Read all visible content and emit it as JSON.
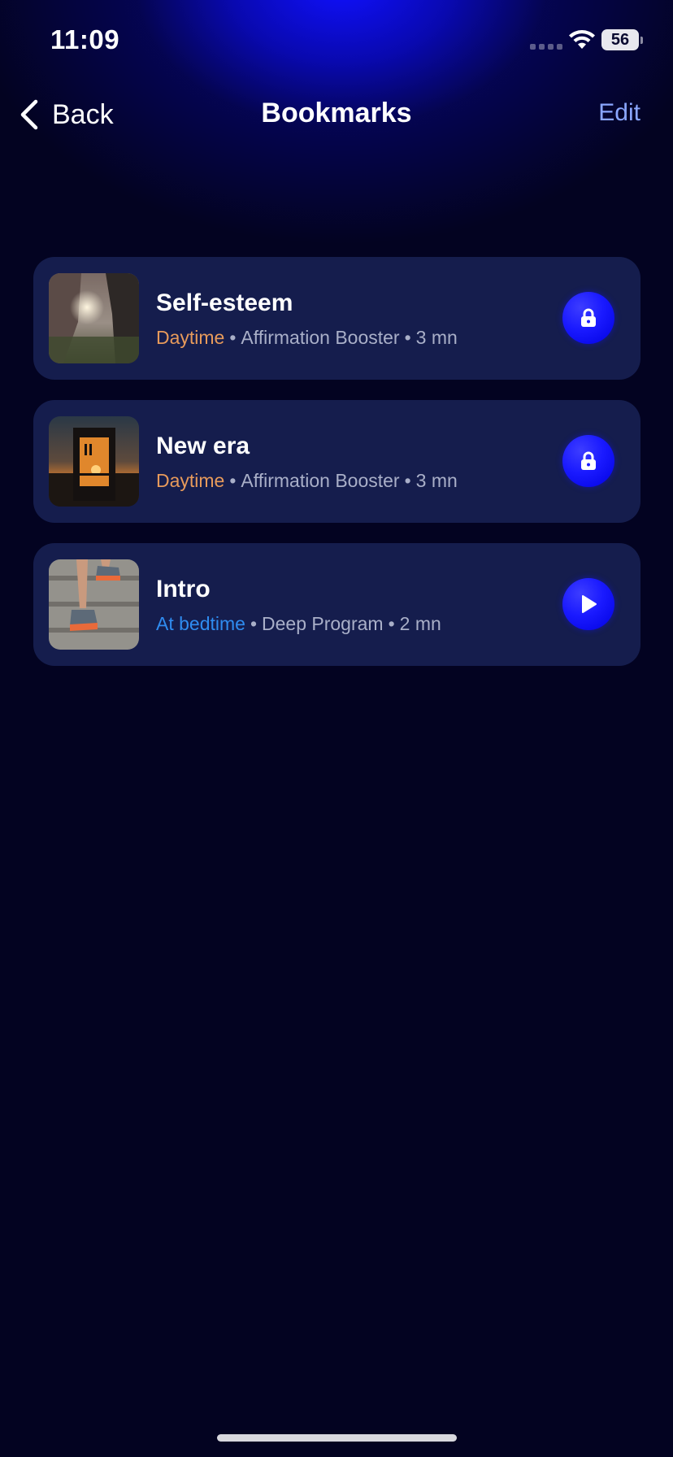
{
  "status_bar": {
    "time": "11:09",
    "battery_level": "56"
  },
  "nav": {
    "back_label": "Back",
    "title": "Bookmarks",
    "edit_label": "Edit"
  },
  "bookmarks": [
    {
      "title": "Self-esteem",
      "timing": "Daytime",
      "timing_color": "#e79a5b",
      "program": "Affirmation Booster",
      "duration": "3 mn",
      "action": "lock-icon"
    },
    {
      "title": "New era",
      "timing": "Daytime",
      "timing_color": "#e79a5b",
      "program": "Affirmation Booster",
      "duration": "3 mn",
      "action": "lock-icon"
    },
    {
      "title": "Intro",
      "timing": "At bedtime",
      "timing_color": "#2f8cf0",
      "program": "Deep Program",
      "duration": "2 mn",
      "action": "play-icon"
    }
  ],
  "meta_separator": "•",
  "colors": {
    "background": "#030321",
    "card": "#151d4d",
    "accent_blue": "#1a1aff",
    "edit_link": "#8aa6ff"
  }
}
